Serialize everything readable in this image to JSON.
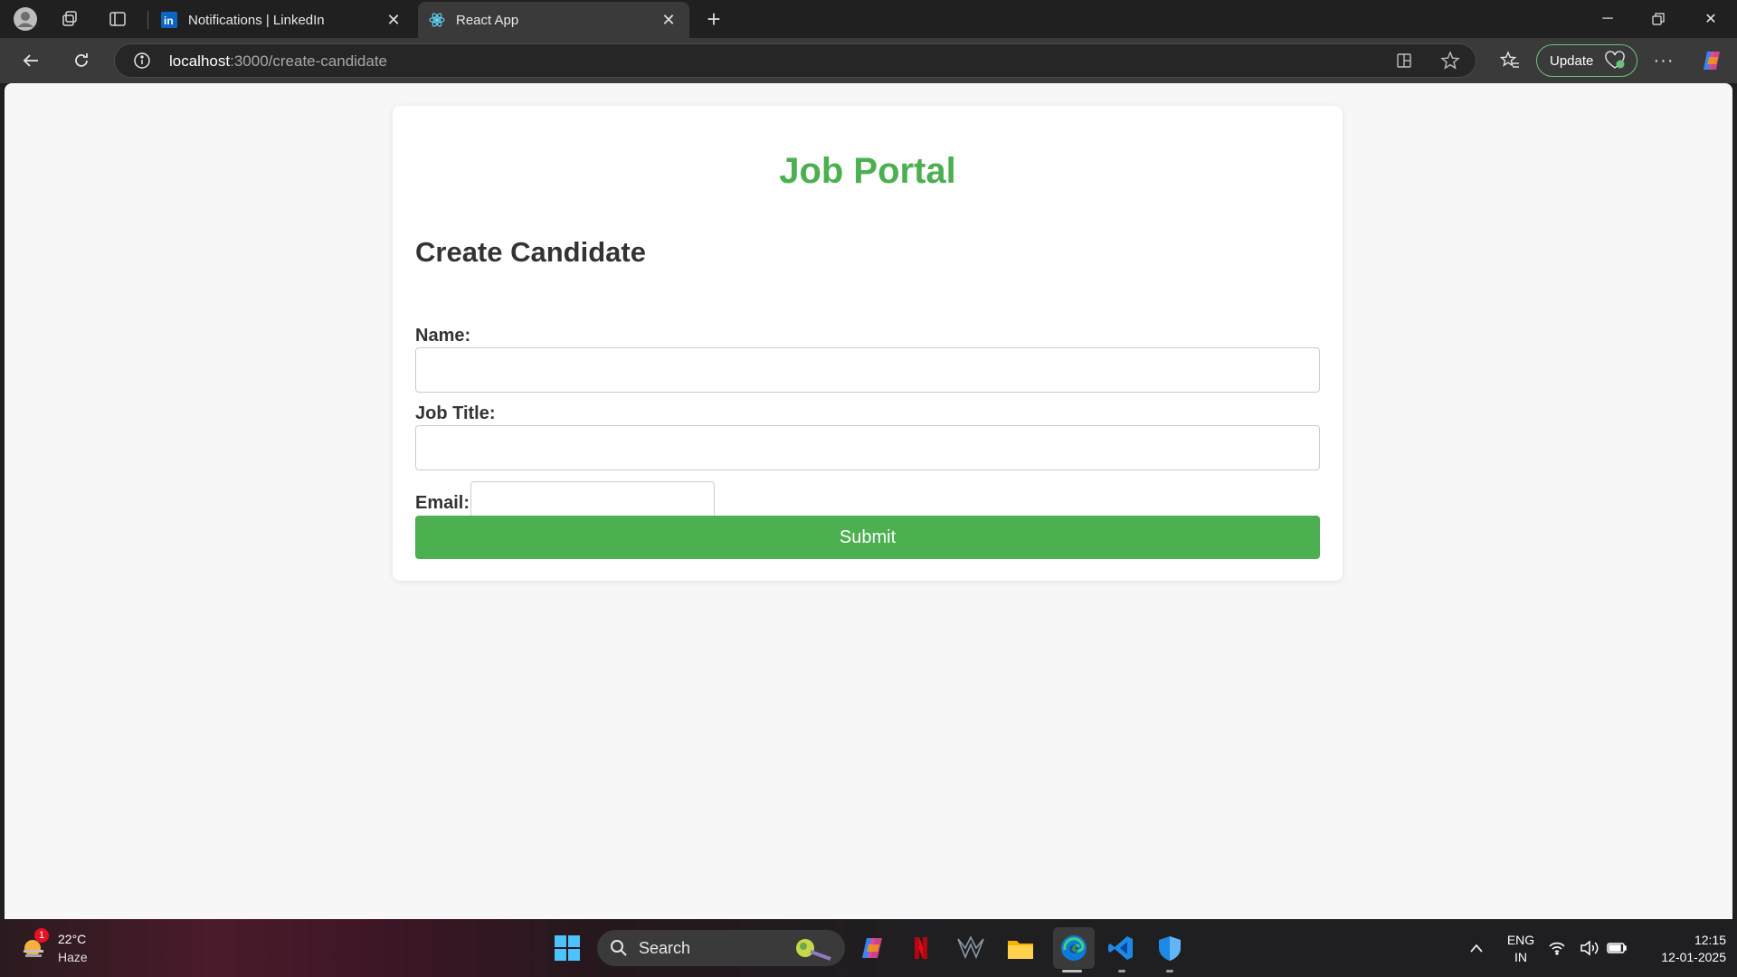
{
  "browser": {
    "tabs": [
      {
        "title": "Notifications | LinkedIn",
        "favicon": "linkedin-icon",
        "active": false
      },
      {
        "title": "React App",
        "favicon": "react-icon",
        "active": true
      }
    ],
    "address": {
      "host": "localhost",
      "path": ":3000/create-candidate"
    },
    "update_label": "Update"
  },
  "page": {
    "portal_title": "Job Portal",
    "form_title": "Create Candidate",
    "fields": {
      "name_label": "Name:",
      "name_value": "",
      "job_title_label": "Job Title:",
      "job_title_value": "",
      "email_label": "Email:",
      "email_value": ""
    },
    "submit_label": "Submit"
  },
  "colors": {
    "accent_green": "#4caf50",
    "heading_text": "#333333"
  },
  "taskbar": {
    "weather": {
      "temp": "22°C",
      "condition": "Haze",
      "badge": "1"
    },
    "search_label": "Search",
    "lang_top": "ENG",
    "lang_bottom": "IN",
    "time": "12:15",
    "date": "12-01-2025"
  }
}
